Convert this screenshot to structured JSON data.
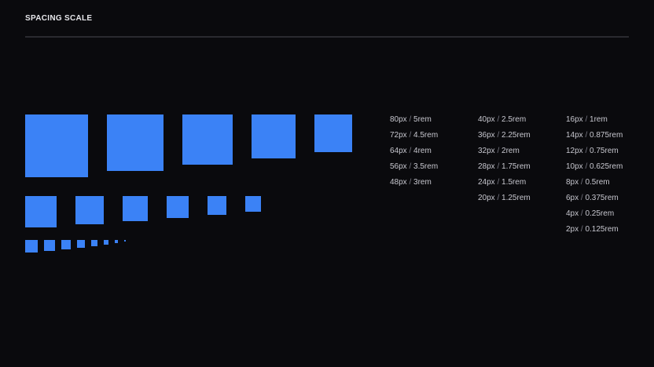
{
  "header": {
    "title": "SPACING SCALE"
  },
  "colors": {
    "background": "#0a0a0d",
    "swatch": "#3b82f6",
    "divider": "#2a2a2f"
  },
  "rows": [
    [
      80,
      72,
      64,
      56,
      48
    ],
    [
      40,
      36,
      32,
      28,
      24,
      20
    ],
    [
      16,
      14,
      12,
      10,
      8,
      6,
      4,
      2
    ]
  ],
  "columns": [
    [
      {
        "px": "80px",
        "rem": "5rem"
      },
      {
        "px": "72px",
        "rem": "4.5rem"
      },
      {
        "px": "64px",
        "rem": "4rem"
      },
      {
        "px": "56px",
        "rem": "3.5rem"
      },
      {
        "px": "48px",
        "rem": "3rem"
      }
    ],
    [
      {
        "px": "40px",
        "rem": "2.5rem"
      },
      {
        "px": "36px",
        "rem": "2.25rem"
      },
      {
        "px": "32px",
        "rem": "2rem"
      },
      {
        "px": "28px",
        "rem": "1.75rem"
      },
      {
        "px": "24px",
        "rem": "1.5rem"
      },
      {
        "px": "20px",
        "rem": "1.25rem"
      }
    ],
    [
      {
        "px": "16px",
        "rem": "1rem"
      },
      {
        "px": "14px",
        "rem": "0.875rem"
      },
      {
        "px": "12px",
        "rem": "0.75rem"
      },
      {
        "px": "10px",
        "rem": "0.625rem"
      },
      {
        "px": "8px",
        "rem": "0.5rem"
      },
      {
        "px": "6px",
        "rem": "0.375rem"
      },
      {
        "px": "4px",
        "rem": "0.25rem"
      },
      {
        "px": "2px",
        "rem": "0.125rem"
      }
    ]
  ]
}
